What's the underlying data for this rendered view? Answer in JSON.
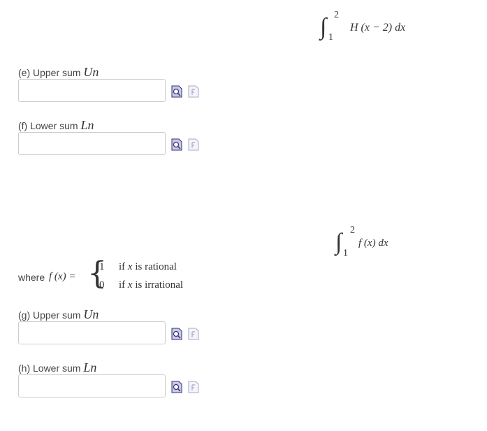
{
  "integral_1": {
    "upper": "2",
    "lower": "1",
    "integrand": "H (x − 2) dx"
  },
  "part_e": {
    "label": "(e) Upper sum",
    "symbol": "Un",
    "value": ""
  },
  "part_f": {
    "label": "(f) Lower sum",
    "symbol": "Ln",
    "value": ""
  },
  "integral_2": {
    "upper": "2",
    "lower": "1",
    "integrand": "f (x)  dx"
  },
  "definition": {
    "where_text": "where",
    "function_name": "f (x) =",
    "cases": [
      {
        "value": "1",
        "condition_prefix": "if",
        "var": "x",
        "condition_suffix": "is rational"
      },
      {
        "value": "0",
        "condition_prefix": "if",
        "var": "x",
        "condition_suffix": "is irrational"
      }
    ]
  },
  "part_g": {
    "label": "(g) Upper sum",
    "symbol": "Un",
    "value": ""
  },
  "part_h": {
    "label": "(h) Lower sum",
    "symbol": "Ln",
    "value": ""
  },
  "icons": {
    "preview": "preview-magnifier-icon",
    "formula": "formula-page-icon"
  },
  "colors": {
    "preview_icon_fill": "#c8c8f0",
    "preview_icon_stroke": "#333366",
    "formula_icon_stroke": "#a8a8c8",
    "input_border": "#cccccc"
  }
}
